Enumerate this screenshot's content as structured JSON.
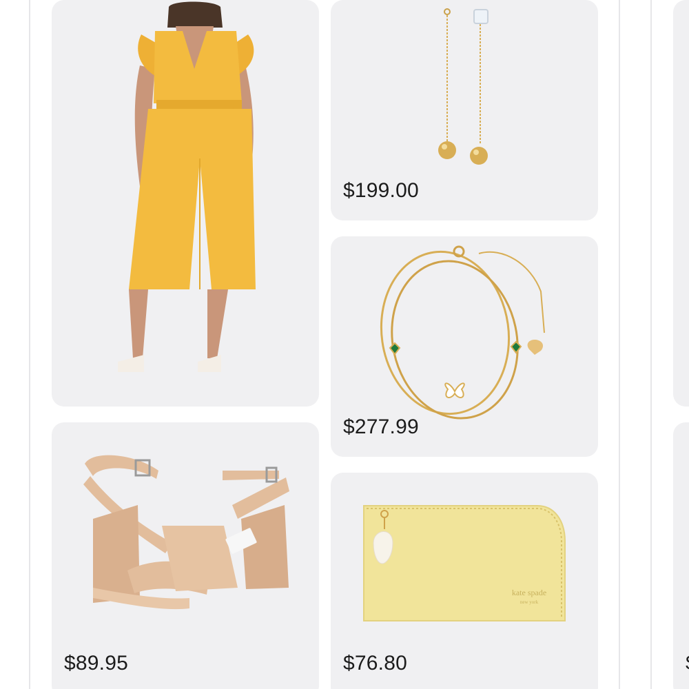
{
  "products": [
    {
      "id": "jumpsuit",
      "name": "yellow jumpsuit",
      "price": ""
    },
    {
      "id": "earrings",
      "name": "gold drop earrings",
      "price": "$199.00"
    },
    {
      "id": "bracelet",
      "name": "gold layered bracelet",
      "price": "$277.99"
    },
    {
      "id": "sandals",
      "name": "nude block heel sandals",
      "price": "$89.95"
    },
    {
      "id": "wallet",
      "name": "yellow zip wallet",
      "price": "$76.80"
    }
  ],
  "partial_price_glyph": "$",
  "wallet_brand": {
    "line1": "kate spade",
    "line2": "new york"
  },
  "colors": {
    "card_bg": "#f0f0f2",
    "jumpsuit": "#f3bb3f",
    "gold": "#d8ae55",
    "nude": "#e2bd9c",
    "wallet": "#f1e49a"
  }
}
